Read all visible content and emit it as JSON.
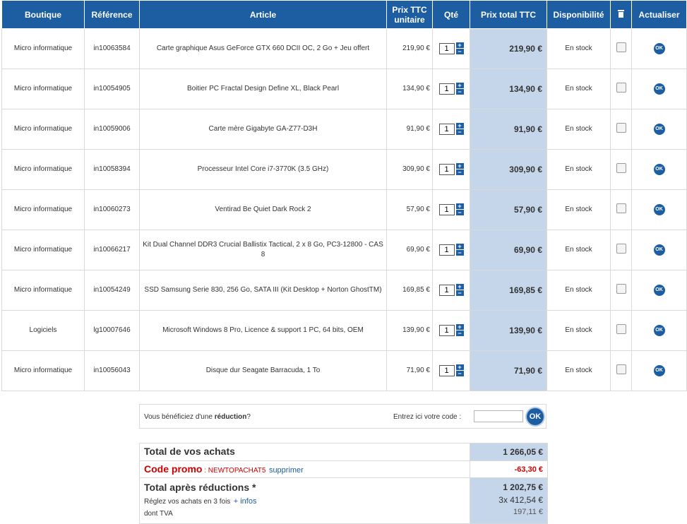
{
  "headers": {
    "boutique": "Boutique",
    "reference": "Référence",
    "article": "Article",
    "prix_unitaire": "Prix TTC unitaire",
    "qte": "Qté",
    "prix_total": "Prix total TTC",
    "disponibilite": "Disponibilité",
    "actualiser": "Actualiser"
  },
  "rows": [
    {
      "boutique": "Micro informatique",
      "reference": "in10063584",
      "article": "Carte graphique Asus GeForce GTX 660 DCII OC, 2 Go + Jeu offert",
      "prix_unitaire": "219,90 €",
      "qte": "1",
      "prix_total": "219,90 €",
      "disponibilite": "En stock",
      "ok": "OK"
    },
    {
      "boutique": "Micro informatique",
      "reference": "in10054905",
      "article": "Boitier PC Fractal Design Define XL, Black Pearl",
      "prix_unitaire": "134,90 €",
      "qte": "1",
      "prix_total": "134,90 €",
      "disponibilite": "En stock",
      "ok": "OK"
    },
    {
      "boutique": "Micro informatique",
      "reference": "in10059006",
      "article": "Carte mère Gigabyte GA-Z77-D3H",
      "prix_unitaire": "91,90 €",
      "qte": "1",
      "prix_total": "91,90 €",
      "disponibilite": "En stock",
      "ok": "OK"
    },
    {
      "boutique": "Micro informatique",
      "reference": "in10058394",
      "article": "Processeur Intel Core i7-3770K (3.5 GHz)",
      "prix_unitaire": "309,90 €",
      "qte": "1",
      "prix_total": "309,90 €",
      "disponibilite": "En stock",
      "ok": "OK"
    },
    {
      "boutique": "Micro informatique",
      "reference": "in10060273",
      "article": "Ventirad Be Quiet Dark Rock 2",
      "prix_unitaire": "57,90 €",
      "qte": "1",
      "prix_total": "57,90 €",
      "disponibilite": "En stock",
      "ok": "OK"
    },
    {
      "boutique": "Micro informatique",
      "reference": "in10066217",
      "article": "Kit Dual Channel DDR3 Crucial Ballistix Tactical, 2 x 8 Go, PC3-12800 - CAS 8",
      "prix_unitaire": "69,90 €",
      "qte": "1",
      "prix_total": "69,90 €",
      "disponibilite": "En stock",
      "ok": "OK"
    },
    {
      "boutique": "Micro informatique",
      "reference": "in10054249",
      "article": "SSD Samsung Serie 830, 256 Go, SATA III (Kit Desktop + Norton GhostTM)",
      "prix_unitaire": "169,85 €",
      "qte": "1",
      "prix_total": "169,85 €",
      "disponibilite": "En stock",
      "ok": "OK"
    },
    {
      "boutique": "Logiciels",
      "reference": "lg10007646",
      "article": "Microsoft Windows 8 Pro, Licence & support 1 PC, 64 bits, OEM",
      "prix_unitaire": "139,90 €",
      "qte": "1",
      "prix_total": "139,90 €",
      "disponibilite": "En stock",
      "ok": "OK"
    },
    {
      "boutique": "Micro informatique",
      "reference": "in10056043",
      "article": "Disque dur Seagate Barracuda, 1 To",
      "prix_unitaire": "71,90 €",
      "qte": "1",
      "prix_total": "71,90 €",
      "disponibilite": "En stock",
      "ok": "OK"
    }
  ],
  "stepper": {
    "plus": "+",
    "minus": "−"
  },
  "promo": {
    "question_pre": "Vous bénéficiez d'une ",
    "question_bold": "réduction",
    "question_post": "?",
    "enter_label": "Entrez ici votre code :",
    "input_value": "",
    "ok_label": "OK"
  },
  "summary": {
    "total_label": "Total de vos achats",
    "total_value": "1 266,05 €",
    "promo_label": "Code promo",
    "promo_sep": " : ",
    "promo_code": "NEWTOPACHAT5",
    "promo_remove": "supprimer",
    "promo_value": "-63,30 €",
    "after_label": "Total après réductions *",
    "after_value": "1 202,75 €",
    "installments_label": "Réglez vos achats en 3 fois",
    "installments_link": "+ infos",
    "installments_value": "3x  412,54 €",
    "tva_label": "dont TVA",
    "tva_value": "197,11 €"
  },
  "colors": {
    "header": "#1d5ea3",
    "total_col": "#c5d5ea",
    "promo_red": "#cc0000"
  },
  "icons": {
    "delete": "trash-icon",
    "update": "ok-button-icon"
  }
}
